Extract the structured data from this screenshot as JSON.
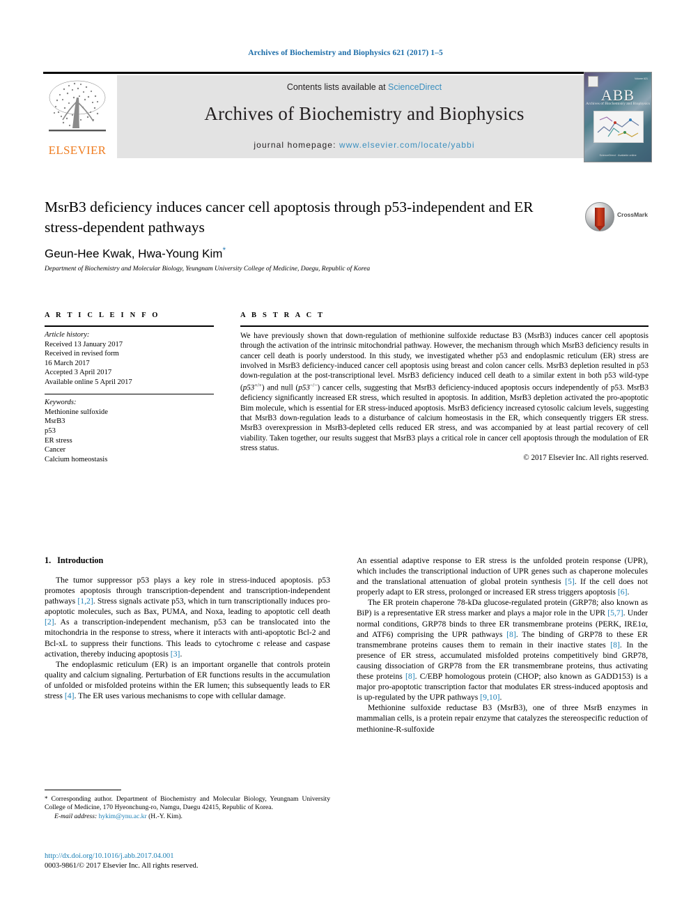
{
  "running_head": "Archives of Biochemistry and Biophysics 621 (2017) 1–5",
  "masthead": {
    "contents_prefix": "Contents lists available at ",
    "sciencedirect": "ScienceDirect",
    "journal_title": "Archives of Biochemistry and Biophysics",
    "homepage_prefix": "journal homepage: ",
    "homepage_url": "www.elsevier.com/locate/yabbi",
    "publisher_name": "ELSEVIER",
    "cover": {
      "acronym": "ABB",
      "subtitle": "Archives of Biochemistry and Biophysics",
      "issue_label": "Volume 621",
      "footer_label": "ScienceDirect · Available online"
    },
    "accent_link_color": "#3a8fbf",
    "publisher_color": "#ef7d21"
  },
  "article": {
    "title": "MsrB3 deficiency induces cancer cell apoptosis through p53-independent and ER stress-dependent pathways",
    "authors": "Geun-Hee Kwak, Hwa-Young Kim",
    "corresponding_mark": "*",
    "affiliation": "Department of Biochemistry and Molecular Biology, Yeungnam University College of Medicine, Daegu, Republic of Korea",
    "crossmark_label": "CrossMark"
  },
  "article_info": {
    "heading": "A R T I C L E   I N F O",
    "history_label": "Article history:",
    "history": [
      "Received 13 January 2017",
      "Received in revised form",
      "16 March 2017",
      "Accepted 3 April 2017",
      "Available online 5 April 2017"
    ],
    "keywords_label": "Keywords:",
    "keywords": [
      "Methionine sulfoxide",
      "MsrB3",
      "p53",
      "ER stress",
      "Cancer",
      "Calcium homeostasis"
    ]
  },
  "abstract": {
    "heading": "A B S T R A C T",
    "part1": "We have previously shown that down-regulation of methionine sulfoxide reductase B3 (MsrB3) induces cancer cell apoptosis through the activation of the intrinsic mitochondrial pathway. However, the mechanism through which MsrB3 deficiency results in cancer cell death is poorly understood. In this study, we investigated whether p53 and endoplasmic reticulum (ER) stress are involved in MsrB3 deficiency-induced cancer cell apoptosis using breast and colon cancer cells. MsrB3 depletion resulted in p53 down-regulation at the post-transcriptional level. MsrB3 deficiency induced cell death to a similar extent in both p53 wild-type (",
    "p53_wt_italic": "p53",
    "p53_wt_sup": "+/+",
    "mid1": ") and null (",
    "p53_null_italic": "p53",
    "p53_null_sup": "−/−",
    "part2": ") cancer cells, suggesting that MsrB3 deficiency-induced apoptosis occurs independently of p53. MsrB3 deficiency significantly increased ER stress, which resulted in apoptosis. In addition, MsrB3 depletion activated the pro-apoptotic Bim molecule, which is essential for ER stress-induced apoptosis. MsrB3 deficiency increased cytosolic calcium levels, suggesting that MsrB3 down-regulation leads to a disturbance of calcium homeostasis in the ER, which consequently triggers ER stress. MsrB3 overexpression in MsrB3-depleted cells reduced ER stress, and was accompanied by at least partial recovery of cell viability. Taken together, our results suggest that MsrB3 plays a critical role in cancer cell apoptosis through the modulation of ER stress status.",
    "copyright": "© 2017 Elsevier Inc. All rights reserved."
  },
  "introduction": {
    "number": "1.",
    "heading": "Introduction",
    "left_paragraph_1_a": "The tumor suppressor p53 plays a key role in stress-induced apoptosis. p53 promotes apoptosis through transcription-dependent and transcription-independent pathways ",
    "ref_1_2": "[1,2]",
    "left_paragraph_1_b": ". Stress signals activate p53, which in turn transcriptionally induces pro-apoptotic molecules, such as Bax, PUMA, and Noxa, leading to apoptotic cell death ",
    "ref_2": "[2]",
    "left_paragraph_1_c": ". As a transcription-independent mechanism, p53 can be translocated into the mitochondria in the response to stress, where it interacts with anti-apoptotic Bcl-2 and Bcl-xL to suppress their functions. This leads to cytochrome c release and caspase activation, thereby inducing apoptosis ",
    "ref_3": "[3]",
    "left_paragraph_1_d": ".",
    "left_paragraph_2_a": "The endoplasmic reticulum (ER) is an important organelle that controls protein quality and calcium signaling. Perturbation of ER functions results in the accumulation of unfolded or misfolded proteins within the ER lumen; this subsequently leads to ER stress ",
    "ref_4": "[4]",
    "left_paragraph_2_b": ". The ER uses various mechanisms to cope with cellular damage.",
    "right_paragraph_1_a": "An essential adaptive response to ER stress is the unfolded protein response (UPR), which includes the transcriptional induction of UPR genes such as chaperone molecules and the translational attenuation of global protein synthesis ",
    "ref_5": "[5]",
    "right_paragraph_1_b": ". If the cell does not properly adapt to ER stress, prolonged or increased ER stress triggers apoptosis ",
    "ref_6": "[6]",
    "right_paragraph_1_c": ".",
    "right_paragraph_2_a": "The ER protein chaperone 78-kDa glucose-regulated protein (GRP78; also known as BiP) is a representative ER stress marker and plays a major role in the UPR ",
    "ref_5_7": "[5,7]",
    "right_paragraph_2_b": ". Under normal conditions, GRP78 binds to three ER transmembrane proteins (PERK, IRE1α, and ATF6) comprising the UPR pathways ",
    "ref_8a": "[8]",
    "right_paragraph_2_c": ". The binding of GRP78 to these ER transmembrane proteins causes them to remain in their inactive states ",
    "ref_8b": "[8]",
    "right_paragraph_2_d": ". In the presence of ER stress, accumulated misfolded proteins competitively bind GRP78, causing dissociation of GRP78 from the ER transmembrane proteins, thus activating these proteins ",
    "ref_8c": "[8]",
    "right_paragraph_2_e": ". C/EBP homologous protein (CHOP; also known as GADD153) is a major pro-apoptotic transcription factor that modulates ER stress-induced apoptosis and is up-regulated by the UPR pathways ",
    "ref_9_10": "[9,10]",
    "right_paragraph_2_f": ".",
    "right_paragraph_3": "Methionine sulfoxide reductase B3 (MsrB3), one of three MsrB enzymes in mammalian cells, is a protein repair enzyme that catalyzes the stereospecific reduction of methionine-R-sulfoxide"
  },
  "footnotes": {
    "star": "*",
    "corresponding_text": " Corresponding author. Department of Biochemistry and Molecular Biology, Yeungnam University College of Medicine, 170 Hyeonchung-ro, Namgu, Daegu 42415, Republic of Korea.",
    "email_label": "E-mail address:",
    "email": "hykim@ynu.ac.kr",
    "email_suffix": " (H.-Y. Kim)."
  },
  "imprint": {
    "doi": "http://dx.doi.org/10.1016/j.abb.2017.04.001",
    "issn_line": "0003-9861/© 2017 Elsevier Inc. All rights reserved."
  }
}
